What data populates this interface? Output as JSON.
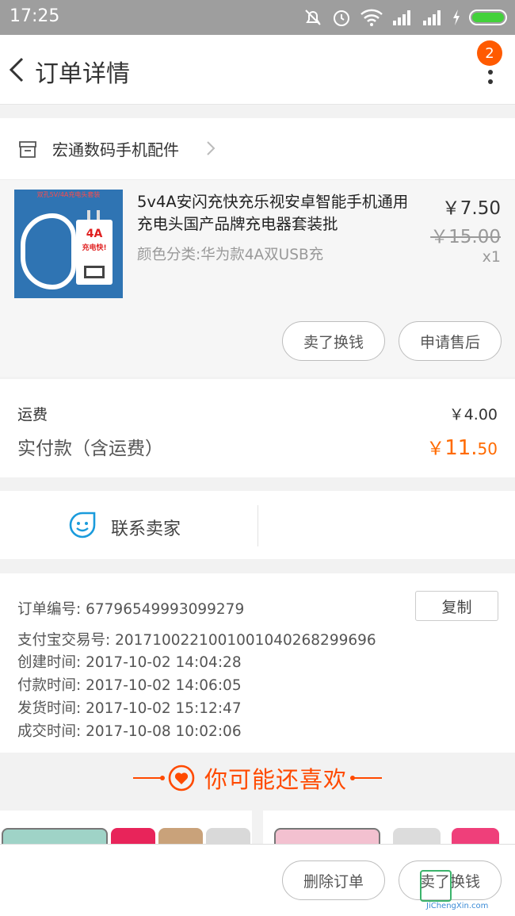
{
  "status_bar": {
    "time": "17:25"
  },
  "header": {
    "title": "订单详情",
    "badge_count": "2"
  },
  "shop": {
    "name": "宏通数码手机配件"
  },
  "product": {
    "title": "5v4A安闪充快充乐视安卓智能手机通用充电头国产品牌充电器套装批",
    "spec": "颜色分类:华为款4A双USB充",
    "price": "￥7.50",
    "original_price": "￥15.00",
    "quantity": "x1",
    "thumb_banner": "双孔5V/4A充电头套装",
    "thumb_amp": "4A",
    "thumb_fast": "充电快!",
    "actions": [
      "卖了换钱",
      "申请售后"
    ]
  },
  "fees": {
    "shipping_label": "运费",
    "shipping_value": "￥4.00",
    "paid_label": "实付款（含运费）",
    "paid_symbol": "￥",
    "paid_int": "11.",
    "paid_dec": "50"
  },
  "contact": {
    "label": "联系卖家"
  },
  "order_info": {
    "order_no": "订单编号:  67796549993099279",
    "copy_label": "复制",
    "alipay_no": "支付宝交易号:  2017100221001001040268299696",
    "created": "创建时间:  2017-10-02 14:04:28",
    "paid": "付款时间:  2017-10-02 14:06:05",
    "shipped": "发货时间:  2017-10-02 15:12:47",
    "completed": "成交时间:  2017-10-08 10:02:06"
  },
  "recommend": {
    "title": "你可能还喜欢"
  },
  "bottom_bar": {
    "delete_label": "删除订单",
    "sell_label": "卖了换钱"
  },
  "watermark": {
    "text": "JiChengXin.com"
  },
  "colors": {
    "accent": "#ff6a00",
    "status_bar": "#9e9e9e",
    "link_blue": "#1a9bdc"
  }
}
